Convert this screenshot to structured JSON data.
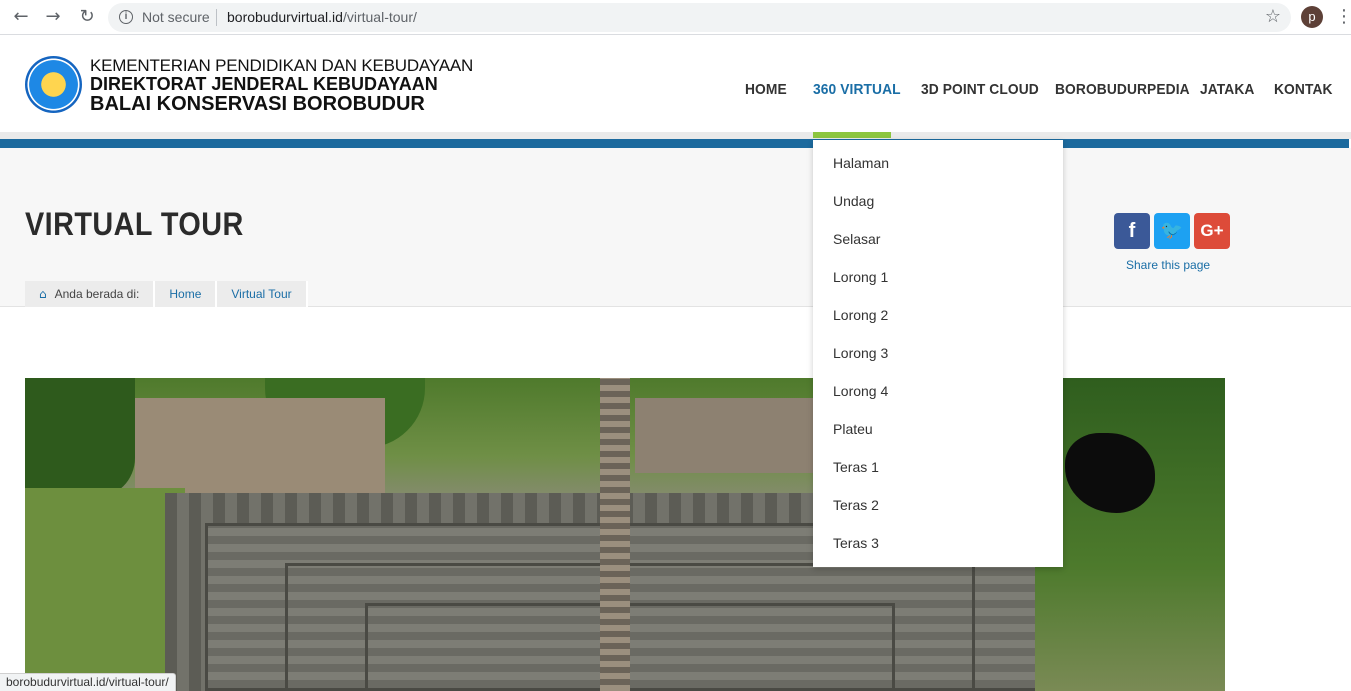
{
  "browser": {
    "back_icon": "arrow-left-icon",
    "forward_icon": "arrow-right-icon",
    "reload_icon": "reload-icon",
    "security_label": "Not secure",
    "url_domain": "borobudurvirtual.id",
    "url_path": "/virtual-tour/",
    "profile_initial": "p",
    "status_url": "borobudurvirtual.id/virtual-tour/"
  },
  "header": {
    "logo_line1": "KEMENTERIAN PENDIDIKAN DAN KEBUDAYAAN",
    "logo_line2": "DIREKTORAT JENDERAL KEBUDAYAAN",
    "logo_line3": "BALAI KONSERVASI BOROBUDUR",
    "nav": [
      {
        "label": "HOME"
      },
      {
        "label": "360 VIRTUAL"
      },
      {
        "label": "3D POINT CLOUD"
      },
      {
        "label": "BOROBUDURPEDIA"
      },
      {
        "label": "JATAKA"
      },
      {
        "label": "KONTAK"
      }
    ],
    "active_nav": "360 VIRTUAL",
    "colors": {
      "active": "#1a6ea6",
      "indicator": "#8dc63f",
      "band": "#1c6a9e"
    }
  },
  "dropdown": {
    "items": [
      "Halaman",
      "Undag",
      "Selasar",
      "Lorong 1",
      "Lorong 2",
      "Lorong 3",
      "Lorong 4",
      "Plateu",
      "Teras 1",
      "Teras 2",
      "Teras 3"
    ]
  },
  "page": {
    "title": "VIRTUAL TOUR",
    "breadcrumb_prefix": "Anda berada di:",
    "breadcrumb": [
      "Home",
      "Virtual Tour"
    ],
    "share_label": "Share this page",
    "share_buttons": [
      {
        "glyph": "f",
        "icon": "facebook-icon",
        "color": "#3b5998"
      },
      {
        "glyph": "🐦",
        "icon": "twitter-icon",
        "color": "#1da1f2"
      },
      {
        "glyph": "G+",
        "icon": "google-plus-icon",
        "color": "#dd4b39"
      }
    ]
  }
}
